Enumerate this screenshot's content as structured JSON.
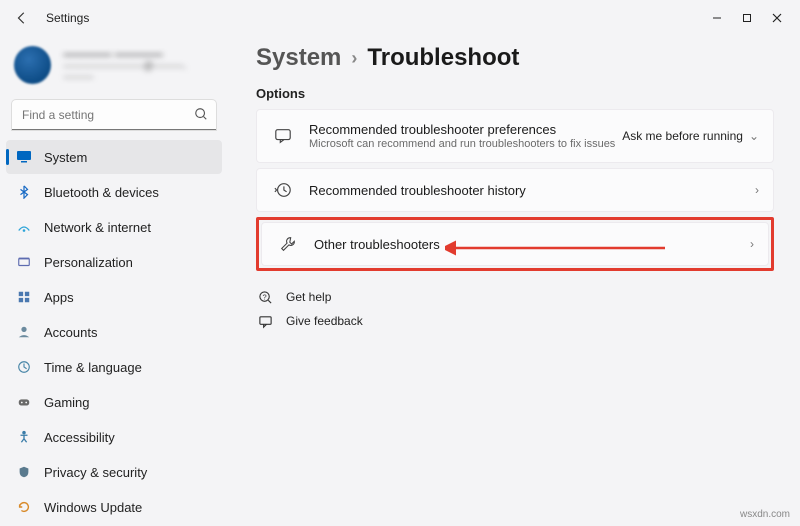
{
  "window": {
    "title": "Settings"
  },
  "profile": {
    "name": "———— ————",
    "email": "————————@———.———"
  },
  "search": {
    "placeholder": "Find a setting"
  },
  "sidebar": {
    "items": [
      {
        "label": "System",
        "icon": "system",
        "active": true
      },
      {
        "label": "Bluetooth & devices",
        "icon": "bluetooth"
      },
      {
        "label": "Network & internet",
        "icon": "network"
      },
      {
        "label": "Personalization",
        "icon": "personalization"
      },
      {
        "label": "Apps",
        "icon": "apps"
      },
      {
        "label": "Accounts",
        "icon": "accounts"
      },
      {
        "label": "Time & language",
        "icon": "time"
      },
      {
        "label": "Gaming",
        "icon": "gaming"
      },
      {
        "label": "Accessibility",
        "icon": "accessibility"
      },
      {
        "label": "Privacy & security",
        "icon": "privacy"
      },
      {
        "label": "Windows Update",
        "icon": "update"
      }
    ]
  },
  "breadcrumb": {
    "parent": "System",
    "current": "Troubleshoot"
  },
  "section": {
    "label": "Options"
  },
  "cards": {
    "prefs": {
      "title": "Recommended troubleshooter preferences",
      "sub": "Microsoft can recommend and run troubleshooters to fix issues",
      "action": "Ask me before running"
    },
    "history": {
      "title": "Recommended troubleshooter history"
    },
    "other": {
      "title": "Other troubleshooters"
    }
  },
  "links": {
    "help": "Get help",
    "feedback": "Give feedback"
  },
  "watermark": "wsxdn.com"
}
